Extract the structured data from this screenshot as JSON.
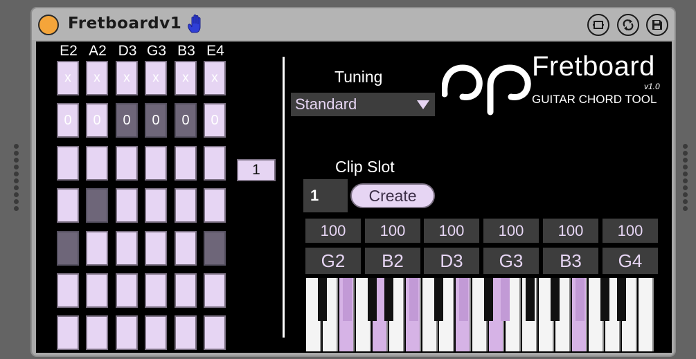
{
  "device": {
    "title": "Fretboardv1",
    "colors": {
      "accent": "#e6d5f3",
      "panel": "#000000",
      "power": "#f5a53a"
    }
  },
  "title_buttons": [
    {
      "icon": "fold-icon"
    },
    {
      "icon": "hotswap-icon"
    },
    {
      "icon": "save-icon"
    }
  ],
  "strings": [
    "E2",
    "A2",
    "D3",
    "G3",
    "B3",
    "E4"
  ],
  "mute_row": [
    "x",
    "x",
    "x",
    "x",
    "x",
    "x"
  ],
  "open_row": [
    "0",
    "0",
    "0",
    "0",
    "0",
    "0"
  ],
  "fret_start": "1",
  "tuning": {
    "label": "Tuning",
    "value": "Standard"
  },
  "logo": {
    "title": "Fretboard",
    "version": "v1.0",
    "subtitle": "GUITAR CHORD TOOL"
  },
  "clip_slot": {
    "label": "Clip Slot",
    "value": "1",
    "create_label": "Create"
  },
  "velocities": [
    "100",
    "100",
    "100",
    "100",
    "100",
    "100"
  ],
  "notes": [
    "G2",
    "B2",
    "D3",
    "G3",
    "B3",
    "G4"
  ]
}
